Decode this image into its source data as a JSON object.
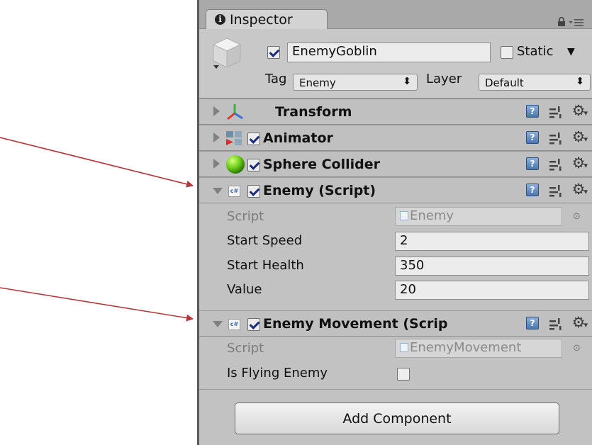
{
  "inspector": {
    "tab_label": "Inspector",
    "object": {
      "name": "EnemyGoblin",
      "active": true,
      "static_label": "Static",
      "tag_label": "Tag",
      "tag_value": "Enemy",
      "layer_label": "Layer",
      "layer_value": "Default"
    },
    "components": {
      "transform": {
        "title": "Transform"
      },
      "animator": {
        "title": "Animator",
        "enabled": true
      },
      "sphere_collider": {
        "title": "Sphere Collider",
        "enabled": true
      },
      "enemy": {
        "title": "Enemy (Script)",
        "enabled": true,
        "script_label": "Script",
        "script_value": "Enemy",
        "start_speed_label": "Start Speed",
        "start_speed_value": "2",
        "start_health_label": "Start Health",
        "start_health_value": "350",
        "value_label": "Value",
        "value_value": "20"
      },
      "enemy_movement": {
        "title": "Enemy Movement (Scrip",
        "enabled": true,
        "script_label": "Script",
        "script_value": "EnemyMovement",
        "is_flying_label": "Is Flying Enemy",
        "is_flying_value": false
      }
    },
    "add_component_label": "Add Component"
  },
  "annotations": {
    "arrow_color": "#b5373b"
  },
  "icons": [
    "info-icon",
    "lock-icon",
    "menu-icon",
    "gameobject-cube-icon",
    "transform-axes-icon",
    "animator-icon",
    "sphere-collider-icon",
    "script-icon",
    "help-icon",
    "preset-icon",
    "gear-icon",
    "object-picker-icon"
  ]
}
